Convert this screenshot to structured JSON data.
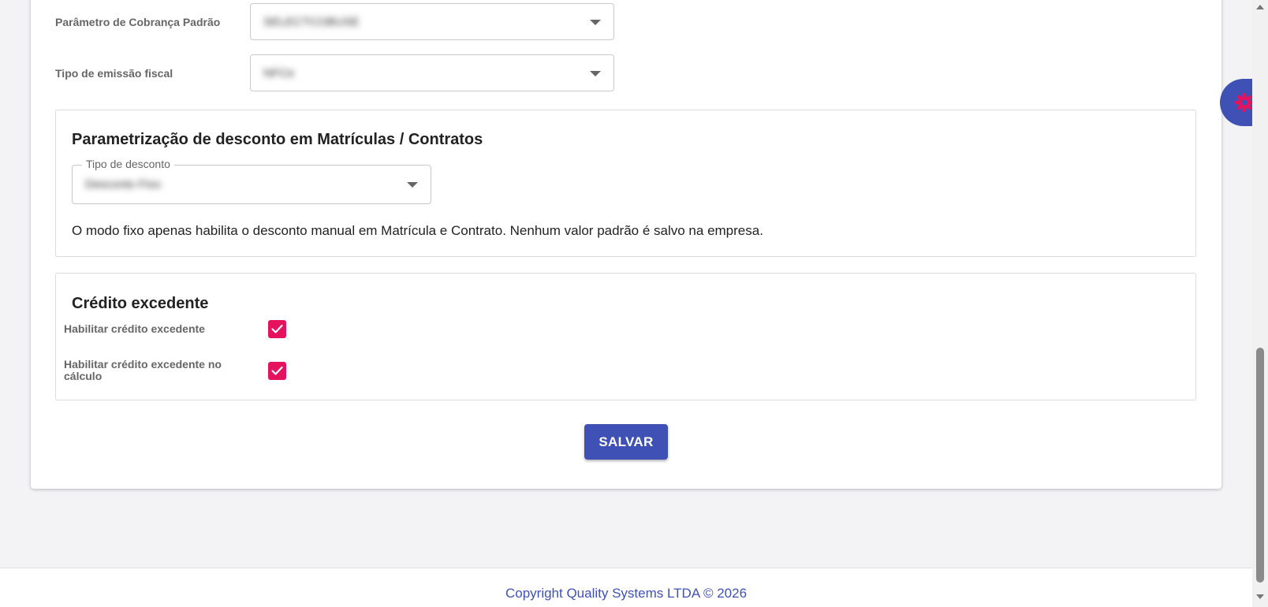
{
  "form": {
    "billing_param": {
      "label": "Parâmetro de Cobrança Padrão",
      "value": "SELECTCOBUSE"
    },
    "fiscal_type": {
      "label": "Tipo de emissão fiscal",
      "value": "NFCe"
    }
  },
  "discount_panel": {
    "title": "Parametrização de desconto em Matrículas / Contratos",
    "field_label": "Tipo de desconto",
    "field_value": "Desconto Fixo",
    "description": "O modo fixo apenas habilita o desconto manual em Matrícula e Contrato. Nenhum valor padrão é salvo na empresa."
  },
  "credit_panel": {
    "title": "Crédito excedente",
    "options": [
      {
        "label": "Habilitar crédito excedente",
        "checked": true
      },
      {
        "label": "Habilitar crédito excedente no cálculo",
        "checked": true
      }
    ]
  },
  "actions": {
    "save_label": "SALVAR"
  },
  "footer": {
    "copyright": "Copyright Quality Systems LTDA © 2026"
  },
  "colors": {
    "primary": "#3f51b5",
    "checkbox": "#e5125e",
    "settings_icon": "#e5125e"
  },
  "icons": {
    "fab": "gear-icon",
    "select_caret": "chevron-down-icon",
    "checkbox": "check-icon"
  }
}
